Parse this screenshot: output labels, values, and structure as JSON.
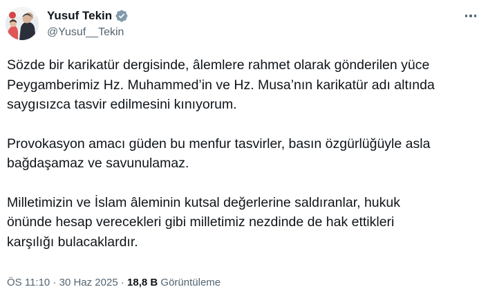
{
  "author": {
    "display_name": "Yusuf Tekin",
    "handle": "@Yusuf__Tekin",
    "verified_icon": "verified-badge-icon",
    "verified_color": "#829aab"
  },
  "post": {
    "paragraphs": [
      [
        "Sözde bir karikatür dergisinde, âlemlere rahmet olarak gönderilen yüce",
        "Peygamberimiz Hz. Muhammed’in ve Hz. Musa’nın karikatür adı altında",
        "saygısızca tasvir edilmesini kınıyorum."
      ],
      [
        "Provokasyon amacı güden bu menfur tasvirler, basın özgürlüğüyle asla",
        "bağdaşamaz ve savunulamaz."
      ],
      [
        "Milletimizin ve İslam âleminin kutsal değerlerine saldıranlar, hukuk",
        "önünde hesap verecekleri gibi milletimiz nezdinde de hak ettikleri",
        "karşılığı bulacaklardır."
      ]
    ]
  },
  "meta": {
    "time": "ÖS 11:10",
    "separator": "·",
    "date": "30 Haz 2025",
    "views_count": "18,8 B",
    "views_label": "Görüntüleme"
  },
  "colors": {
    "text_primary": "#0f1419",
    "text_secondary": "#536471"
  }
}
